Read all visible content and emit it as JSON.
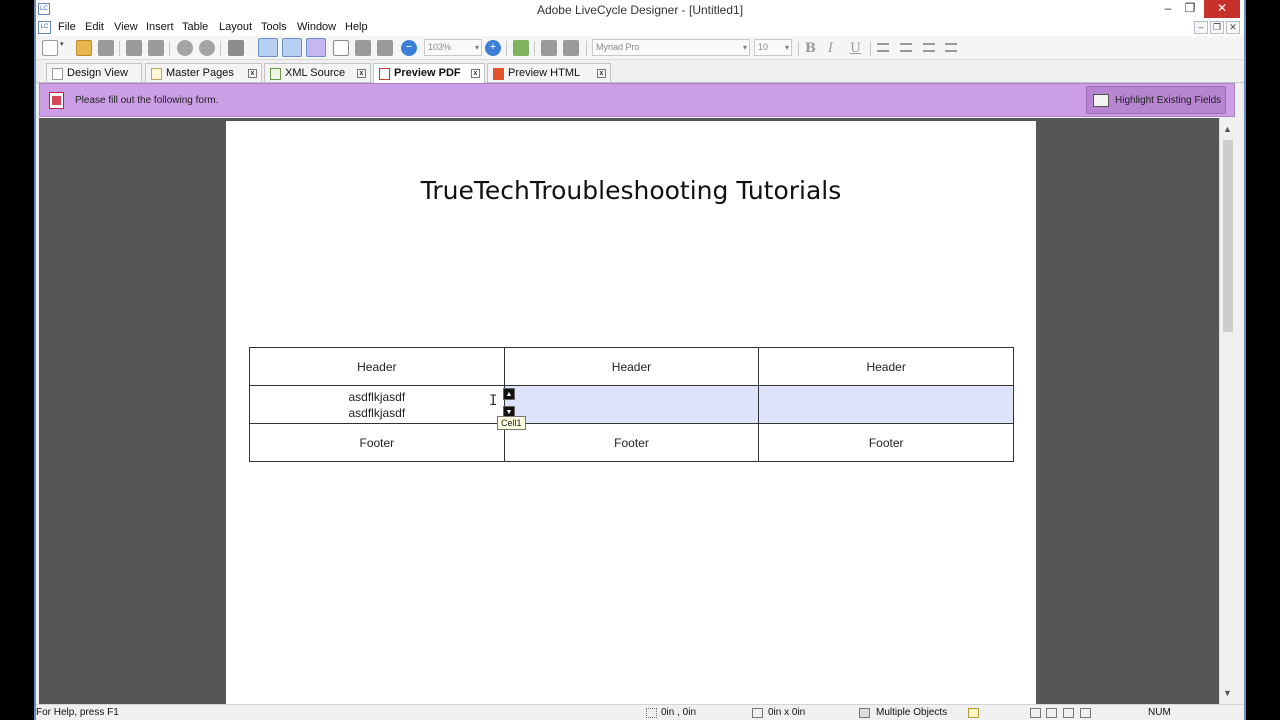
{
  "window": {
    "title": "Adobe LiveCycle Designer - [Untitled1]",
    "app_icon": "LC",
    "min_label": "–",
    "restore_label": "❐",
    "close_label": "✕"
  },
  "menu": {
    "items": [
      "File",
      "Edit",
      "View",
      "Insert",
      "Table",
      "Layout",
      "Tools",
      "Window",
      "Help"
    ],
    "mdi_min": "–",
    "mdi_restore": "❐",
    "mdi_close": "✕"
  },
  "toolbar": {
    "zoom": "103%",
    "font": "Myriad Pro",
    "size": "10",
    "bold": "B",
    "italic": "I",
    "underline": "U"
  },
  "tabs": [
    {
      "label": "Design View",
      "icon": "page-icon"
    },
    {
      "label": "Master Pages",
      "icon": "page-icon"
    },
    {
      "label": "XML Source",
      "icon": "xml-icon"
    },
    {
      "label": "Preview PDF",
      "icon": "pdf-icon",
      "active": true
    },
    {
      "label": "Preview HTML",
      "icon": "html5-icon"
    }
  ],
  "message_bar": {
    "text": "Please fill out the following form.",
    "highlight_button": "Highlight Existing Fields",
    "color": "#cc9ee6"
  },
  "document": {
    "title": "TrueTechTroubleshooting Tutorials",
    "table": {
      "headers": [
        "Header",
        "Header",
        "Header"
      ],
      "body_cell_lines": [
        "asdflkjasdf",
        "asdflkjasdf"
      ],
      "footers": [
        "Footer",
        "Footer",
        "Footer"
      ],
      "field_color": "#dde3fb"
    },
    "tooltip": "Cell1",
    "spin_up": "▲",
    "spin_down": "▼"
  },
  "statusbar": {
    "help": "For Help, press F1",
    "position": "0in , 0in",
    "size": "0in x 0in",
    "selection": "Multiple Objects",
    "num": "NUM"
  }
}
